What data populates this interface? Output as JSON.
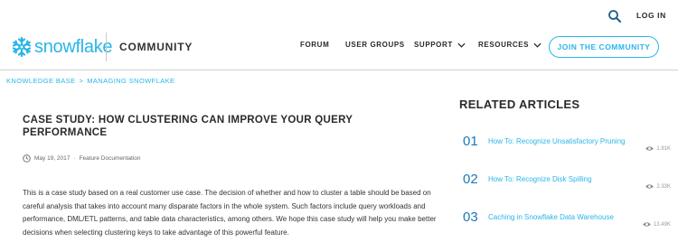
{
  "header": {
    "login_label": "LOG IN",
    "brand_name": "snowflake",
    "community_label": "COMMUNITY",
    "nav": {
      "forum": "FORUM",
      "user_groups": "USER GROUPS",
      "support": "SUPPORT",
      "resources": "RESOURCES"
    },
    "join_button": "JOIN THE COMMUNITY",
    "accent_color": "#29b5e8"
  },
  "breadcrumb": {
    "items": [
      "KNOWLEDGE BASE",
      "MANAGING SNOWFLAKE"
    ],
    "separator": ">"
  },
  "article": {
    "title": "CASE STUDY: HOW CLUSTERING CAN IMPROVE YOUR QUERY PERFORMANCE",
    "date": "May 19, 2017",
    "category": "Feature Documentation",
    "meta_separator": "·",
    "body": "This is a case study based on a real customer use case. The decision of whether and how to cluster a table should be based on careful analysis that takes into account many disparate factors in the whole system. Such factors include query workloads and performance, DML/ETL patterns, and table data characteristics, among others. We hope this case study will help you make better decisions when selecting clustering keys to take advantage of this powerful feature."
  },
  "related": {
    "heading": "RELATED ARTICLES",
    "items": [
      {
        "number": "01",
        "title": "How To: Recognize Unsatisfactory Pruning",
        "views": "1.91K"
      },
      {
        "number": "02",
        "title": "How To: Recognize Disk Spilling",
        "views": "2.33K"
      },
      {
        "number": "03",
        "title": "Caching in Snowflake Data Warehouse",
        "views": "13.49K"
      }
    ]
  },
  "icons": {
    "search": "search-icon",
    "logo": "snowflake-logo-icon",
    "chevron": "chevron-down-icon",
    "clock": "clock-icon",
    "eye": "eye-icon"
  }
}
